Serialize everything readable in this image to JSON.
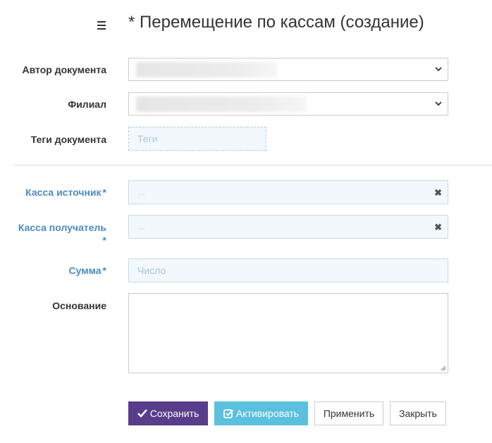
{
  "header": {
    "menu_icon": "hamburger-icon",
    "title": "* Перемещение по кассам (создание)"
  },
  "form": {
    "author": {
      "label": "Автор документа",
      "value": ""
    },
    "branch": {
      "label": "Филиал",
      "value": ""
    },
    "tags": {
      "label": "Теги документа",
      "placeholder": "Теги"
    },
    "cash_source": {
      "label": "Касса источник",
      "required_mark": "*",
      "placeholder": "..."
    },
    "cash_receiver": {
      "label": "Касса получатель",
      "required_mark": "*",
      "placeholder": "..."
    },
    "amount": {
      "label": "Сумма",
      "required_mark": "*",
      "placeholder": "Число"
    },
    "reason": {
      "label": "Основание",
      "value": ""
    }
  },
  "buttons": {
    "save": "Сохранить",
    "activate": "Активировать",
    "apply": "Применить",
    "close": "Закрыть"
  },
  "colors": {
    "required_label": "#4a8bbf",
    "save_button": "#583d8a",
    "activate_button": "#5bc0de",
    "field_bg": "#f2f8fc"
  }
}
